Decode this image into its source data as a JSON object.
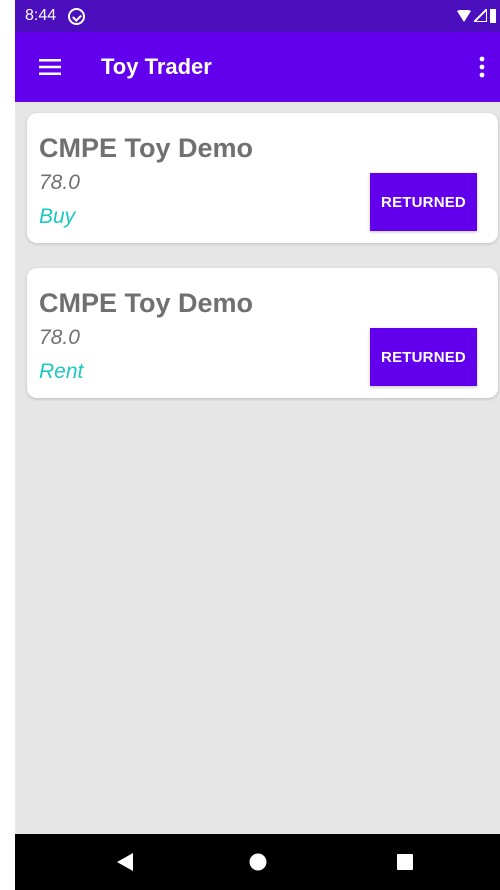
{
  "status_bar": {
    "time": "8:44",
    "icons": [
      "sync-icon",
      "wifi-icon",
      "signal-icon",
      "battery-icon"
    ]
  },
  "app_bar": {
    "title": "Toy Trader",
    "menu_icon": "hamburger-menu-icon",
    "overflow_icon": "more-vert-icon",
    "color": "#6200ee"
  },
  "items": [
    {
      "name": "CMPE Toy Demo",
      "price": "78.0",
      "type": "Buy",
      "button_label": "RETURNED"
    },
    {
      "name": "CMPE Toy Demo",
      "price": "78.0",
      "type": "Rent",
      "button_label": "RETURNED"
    }
  ],
  "nav_bar": {
    "icons": [
      "back-icon",
      "home-icon",
      "recents-icon"
    ]
  },
  "colors": {
    "accent": "#6200ee",
    "status_bar": "#4b0fbe",
    "type_text": "#1dc8c0",
    "background": "#e6e6e6"
  }
}
